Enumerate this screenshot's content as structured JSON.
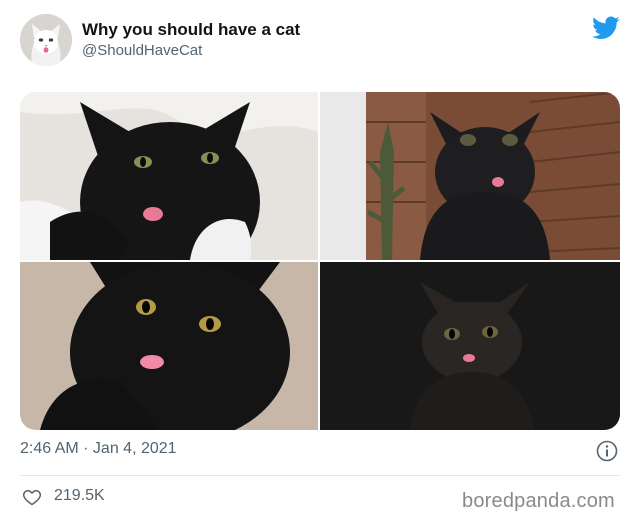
{
  "tweet": {
    "author_name": "Why you should have a cat",
    "author_handle": "@ShouldHaveCat",
    "timestamp": "2:46 AM · Jan 4, 2021",
    "likes": "219.5K",
    "photos": [
      {
        "subject": "black cat with tongue out on white blanket"
      },
      {
        "subject": "black kitten with tongue out near brick wall and cactus"
      },
      {
        "subject": "black cat with tongue out on carpet"
      },
      {
        "subject": "black kitten with tongue out in dark"
      }
    ]
  },
  "icons": {
    "brand": "twitter-bird-icon",
    "info": "info-icon",
    "like": "heart-icon"
  },
  "colors": {
    "twitter_blue": "#1d9bf0",
    "secondary_text": "#536471"
  },
  "watermark": "boredpanda.com"
}
